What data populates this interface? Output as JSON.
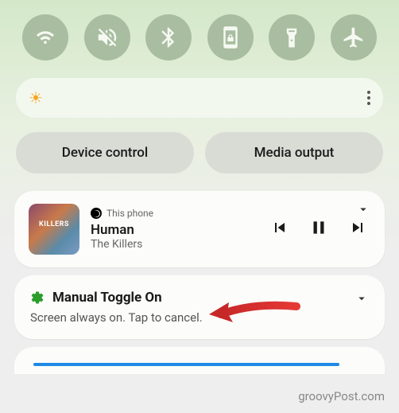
{
  "quick_toggles": [
    {
      "name": "wifi-icon"
    },
    {
      "name": "mute-icon"
    },
    {
      "name": "bluetooth-icon"
    },
    {
      "name": "rotation-lock-icon"
    },
    {
      "name": "flashlight-icon"
    },
    {
      "name": "airplane-icon"
    }
  ],
  "pills": {
    "device_control": "Device control",
    "media_output": "Media output"
  },
  "media": {
    "source": "This phone",
    "title": "Human",
    "artist": "The Killers"
  },
  "notification": {
    "title": "Manual Toggle On",
    "body": "Screen always on. Tap to cancel."
  },
  "watermark": "groovyPost.com"
}
